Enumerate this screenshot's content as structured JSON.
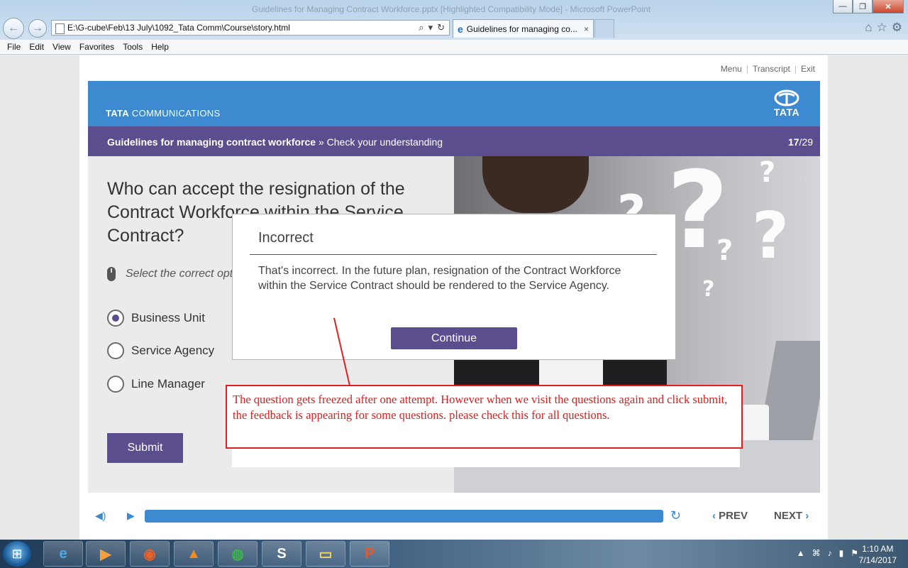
{
  "browser": {
    "window_title": "Guidelines for Managing Contract Workforce.pptx [Highlighted Compatibility Mode] - Microsoft PowerPoint",
    "url": "E:\\G-cube\\Feb\\13 July\\1092_Tata Comm\\Course\\story.html",
    "tab_label": "Guidelines for managing co...",
    "tab_close": "×",
    "menu": [
      "File",
      "Edit",
      "View",
      "Favorites",
      "Tools",
      "Help"
    ]
  },
  "course": {
    "top_links": [
      "Menu",
      "Transcript",
      "Exit"
    ],
    "brand_bold": "TATA",
    "brand_rest": " COMMUNICATIONS",
    "logo_word": "TATA",
    "breadcrumb_title": "Guidelines for managing contract workforce",
    "breadcrumb_sep": " » ",
    "breadcrumb_section": "Check your understanding",
    "page_current": "17",
    "page_total": "/29",
    "question": "Who can accept the resignation of the Contract Workforce within the Service Contract?",
    "instruction": "Select the correct option",
    "options": [
      {
        "label": "Business Unit",
        "checked": true
      },
      {
        "label": "Service Agency",
        "checked": false
      },
      {
        "label": "Line Manager",
        "checked": false
      }
    ],
    "submit_label": "Submit"
  },
  "feedback": {
    "title": "Incorrect",
    "text": "That's incorrect. In the future plan, resignation of the Contract Workforce within the Service Contract should be rendered to the Service Agency.",
    "continue_label": "Continue"
  },
  "annotation": {
    "text": "The question gets freezed after one attempt. However when we visit the questions again and click submit, the feedback is appearing for some questions. please check this for all questions.",
    "color": "#d42323"
  },
  "controls": {
    "progress": 1.0,
    "prev_label": "PREV",
    "next_label": "NEXT"
  },
  "taskbar": {
    "time": "1:10 AM",
    "date": "7/14/2017"
  },
  "colors": {
    "header_blue": "#3d8ad0",
    "purple": "#5c4e8e"
  }
}
